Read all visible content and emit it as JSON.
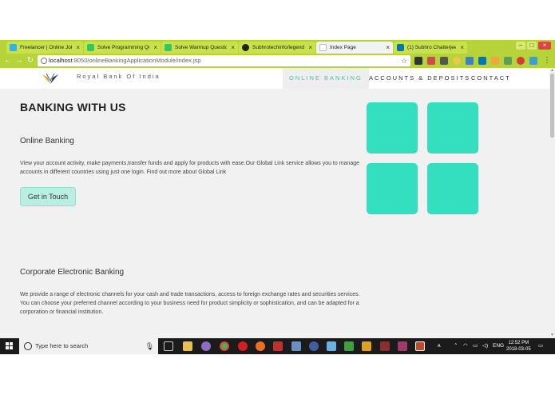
{
  "browser": {
    "tabs": [
      {
        "title": "Freelancer | Online Jobs",
        "favicon_color": "#29b2fe",
        "active": false
      },
      {
        "title": "Solve Programming Qu",
        "favicon_color": "#2ec866",
        "active": false
      },
      {
        "title": "Solve Warmup Questio",
        "favicon_color": "#2ec866",
        "active": false
      },
      {
        "title": "Subhrotechinfo/legend",
        "favicon_color": "#222222",
        "active": false
      },
      {
        "title": "Index Page",
        "favicon_color": "#bbbbbb",
        "active": true
      },
      {
        "title": "(1) Subhro Chatterjee | L",
        "favicon_color": "#0077b5",
        "active": false
      }
    ],
    "address": {
      "host": "localhost",
      "path": ":8050/onlineBankingApplicationModule/index.jsp"
    }
  },
  "site": {
    "brand": "Royal Bank Of India",
    "nav": [
      {
        "label": "ONLINE BANKING",
        "active": true
      },
      {
        "label": "ACCOUNTS & DEPOSITS",
        "active": false
      },
      {
        "label": "CONTACT",
        "active": false
      }
    ],
    "heading": "BANKING WITH US",
    "sections": [
      {
        "title": "Online Banking",
        "text": "View your account activity, make payments,transfer funds and apply for products with ease.Our Global Link service allows you to manage accounts in different countries using just one login. Find out more about Global Link"
      },
      {
        "title": "Corporate Electronic Banking",
        "text": "We provide a range of electronic channels for your cash and trade transactions, access to foreign exchange rates and securities services. You can choose your preferred channel according to your business need for product simplicity or sophistication, and can be adapted for a corporation or financial institution."
      }
    ],
    "cta_label": "Get in Touch",
    "tile_color": "#34dfc0"
  },
  "taskbar": {
    "search_placeholder": "Type here to search",
    "language": "ENG",
    "time": "12:52 PM",
    "date": "2018-03-05"
  }
}
